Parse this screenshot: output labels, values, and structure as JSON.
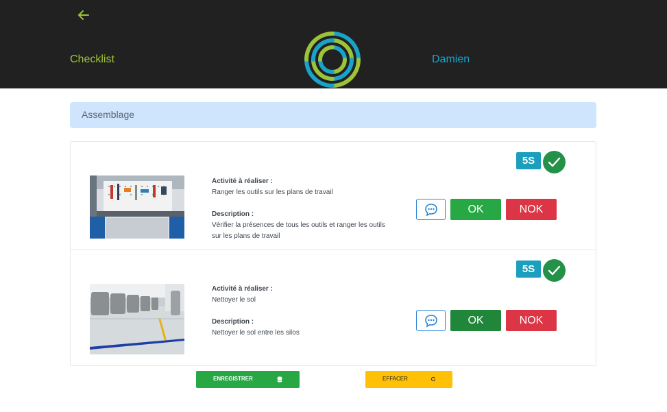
{
  "header": {
    "back_icon": "arrow-left-icon",
    "title": "Checklist",
    "user": "Damien",
    "colors": {
      "background": "#212121",
      "title": "#9dc33a",
      "user": "#1aa3c8"
    }
  },
  "section": {
    "title": "Assemblage"
  },
  "items": [
    {
      "activity_label": "Activité à réaliser :",
      "activity": "Ranger les outils sur les plans de travail",
      "description_label": "Description :",
      "description": "Vérifier la présences de tous les outils et ranger les outils sur les plans de travail",
      "badge": "5S",
      "status_icon": "check-circle-icon",
      "ok_label": "OK",
      "nok_label": "NOK",
      "ok_selected": false
    },
    {
      "activity_label": "Activité à réaliser :",
      "activity": "Nettoyer le sol",
      "description_label": "Description :",
      "description": "Nettoyer le sol entre les silos",
      "badge": "5S",
      "status_icon": "check-circle-icon",
      "ok_label": "OK",
      "nok_label": "NOK",
      "ok_selected": true
    }
  ],
  "footer": {
    "save_label": "ENREGISTRER",
    "clear_label": "EFFACER"
  },
  "colors": {
    "ok": "#28a745",
    "nok": "#dc3545",
    "badge": "#1b9fbd",
    "save": "#28a745",
    "clear": "#ffc107"
  }
}
